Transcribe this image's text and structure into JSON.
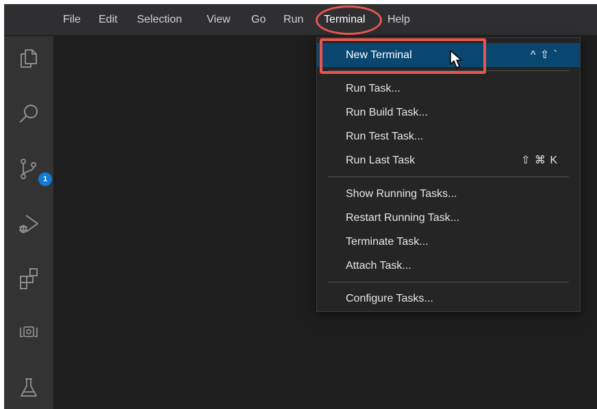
{
  "menubar": {
    "items": [
      "File",
      "Edit",
      "Selection",
      "View",
      "Go",
      "Run",
      "Terminal",
      "Help"
    ],
    "open_menu": "Terminal"
  },
  "activity_bar": {
    "icons": [
      "explorer-icon",
      "search-icon",
      "source-control-icon",
      "run-debug-icon",
      "extensions-icon",
      "remote-explorer-icon",
      "testing-icon"
    ],
    "source_control_badge": "1",
    "badge_color": "#0e7bd6"
  },
  "terminal_menu": {
    "new_terminal": {
      "label": "New Terminal",
      "shortcut": "^ ⇧ `"
    },
    "run_task": {
      "label": "Run Task..."
    },
    "run_build_task": {
      "label": "Run Build Task..."
    },
    "run_test_task": {
      "label": "Run Test Task..."
    },
    "run_last_task": {
      "label": "Run Last Task",
      "shortcut": "⇧ ⌘ K"
    },
    "show_running_tasks": {
      "label": "Show Running Tasks..."
    },
    "restart_running_task": {
      "label": "Restart Running Task..."
    },
    "terminate_task": {
      "label": "Terminate Task..."
    },
    "attach_task": {
      "label": "Attach Task..."
    },
    "configure_tasks": {
      "label": "Configure Tasks..."
    }
  },
  "colors": {
    "annotation": "#e8574f",
    "menu_selection": "#094771",
    "menubar_bg": "#2f2f31",
    "activity_bar_bg": "#333333",
    "editor_bg": "#1e1e1e"
  }
}
